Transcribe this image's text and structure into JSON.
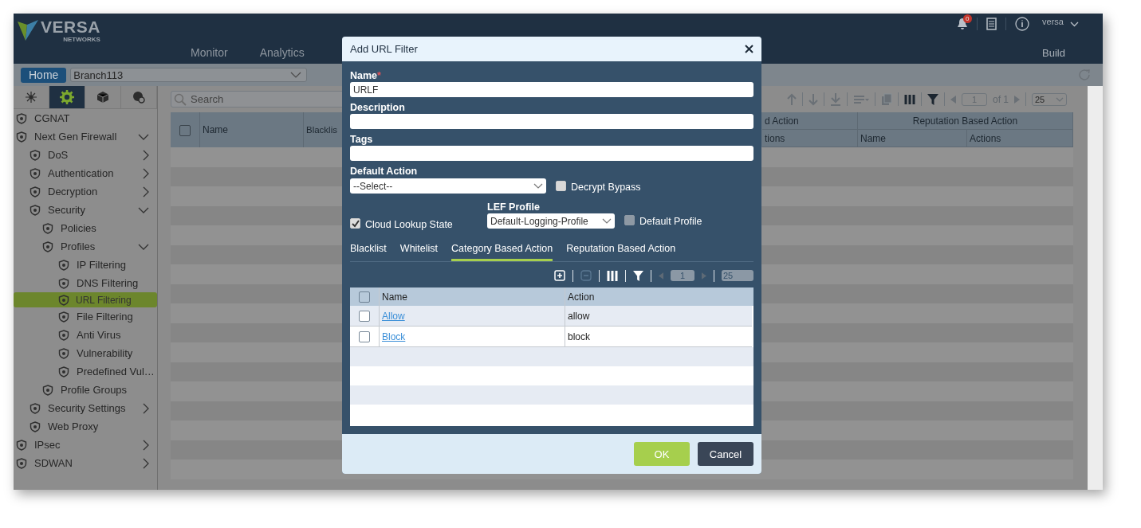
{
  "header": {
    "logo": {
      "name": "VERSA",
      "sub": "NETWORKS"
    },
    "nav": [
      {
        "label": "Monitor"
      },
      {
        "label": "Analytics"
      }
    ],
    "notifications": "0",
    "user": "versa",
    "build": "Build"
  },
  "context_bar": {
    "home": "Home",
    "appliance": "Branch113"
  },
  "sidebar": {
    "tabs": [
      {
        "selected": false
      },
      {
        "selected": true
      },
      {
        "selected": false
      },
      {
        "selected": false
      }
    ],
    "items": [
      {
        "label": "CGNAT",
        "selected": false
      },
      {
        "label": "Next Gen Firewall",
        "selected": false,
        "expanded": true,
        "children": [
          {
            "label": "DoS",
            "selected": false,
            "expanded": false
          },
          {
            "label": "Authentication",
            "selected": false,
            "expanded": false
          },
          {
            "label": "Decryption",
            "selected": false,
            "expanded": false
          },
          {
            "label": "Security",
            "selected": false,
            "expanded": true,
            "children": [
              {
                "label": "Policies",
                "selected": false
              },
              {
                "label": "Profiles",
                "selected": false,
                "expanded": true,
                "children": [
                  {
                    "label": "IP Filtering",
                    "selected": false
                  },
                  {
                    "label": "DNS Filtering",
                    "selected": false
                  },
                  {
                    "label": "URL Filtering",
                    "selected": true
                  },
                  {
                    "label": "File Filtering",
                    "selected": false
                  },
                  {
                    "label": "Anti Virus",
                    "selected": false
                  },
                  {
                    "label": "Vulnerability",
                    "selected": false
                  },
                  {
                    "label": "Predefined Vul…",
                    "selected": false
                  }
                ]
              },
              {
                "label": "Profile Groups",
                "selected": false
              }
            ]
          },
          {
            "label": "Security Settings",
            "selected": false,
            "expanded": false
          },
          {
            "label": "Web Proxy",
            "selected": false
          }
        ]
      },
      {
        "label": "IPsec",
        "selected": false,
        "expanded": false
      },
      {
        "label": "SDWAN",
        "selected": false,
        "expanded": false
      }
    ]
  },
  "main": {
    "search": {
      "placeholder": "Search"
    },
    "pager": {
      "page": "1",
      "of": "of 1",
      "size": "25"
    },
    "table": {
      "all_checked": false,
      "left_columns": [
        "Name",
        "Blacklis"
      ],
      "groups": [
        "d Action",
        "Reputation Based Action"
      ],
      "sub_columns": [
        "tions",
        "Name",
        "Actions"
      ]
    }
  },
  "dialog": {
    "title": "Add URL Filter",
    "name": {
      "label": "Name",
      "required_mark": "*",
      "value": "URLF"
    },
    "description": {
      "label": "Description"
    },
    "tags": {
      "label": "Tags"
    },
    "default_action": {
      "label": "Default Action",
      "value": "--Select--"
    },
    "decrypt_bypass": {
      "label": "Decrypt Bypass",
      "checked": false
    },
    "cloud_lookup_state": {
      "label": "Cloud Lookup State",
      "checked": true
    },
    "lef_profile": {
      "label": "LEF Profile",
      "value": "Default-Logging-Profile"
    },
    "default_profile": {
      "label": "Default Profile",
      "checked": false
    },
    "tabs": [
      {
        "label": "Blacklist",
        "selected": false
      },
      {
        "label": "Whitelist",
        "selected": false
      },
      {
        "label": "Category Based Action",
        "selected": true
      },
      {
        "label": "Reputation Based Action",
        "selected": false
      }
    ],
    "grid": {
      "page": "1",
      "size": "25",
      "all_checked": false,
      "columns": [
        "Name",
        "Action"
      ],
      "rows": [
        {
          "name": "Allow",
          "action": "allow",
          "checked": false
        },
        {
          "name": "Block",
          "action": "block",
          "checked": false
        }
      ]
    },
    "buttons": {
      "ok": "OK",
      "cancel": "Cancel"
    }
  }
}
